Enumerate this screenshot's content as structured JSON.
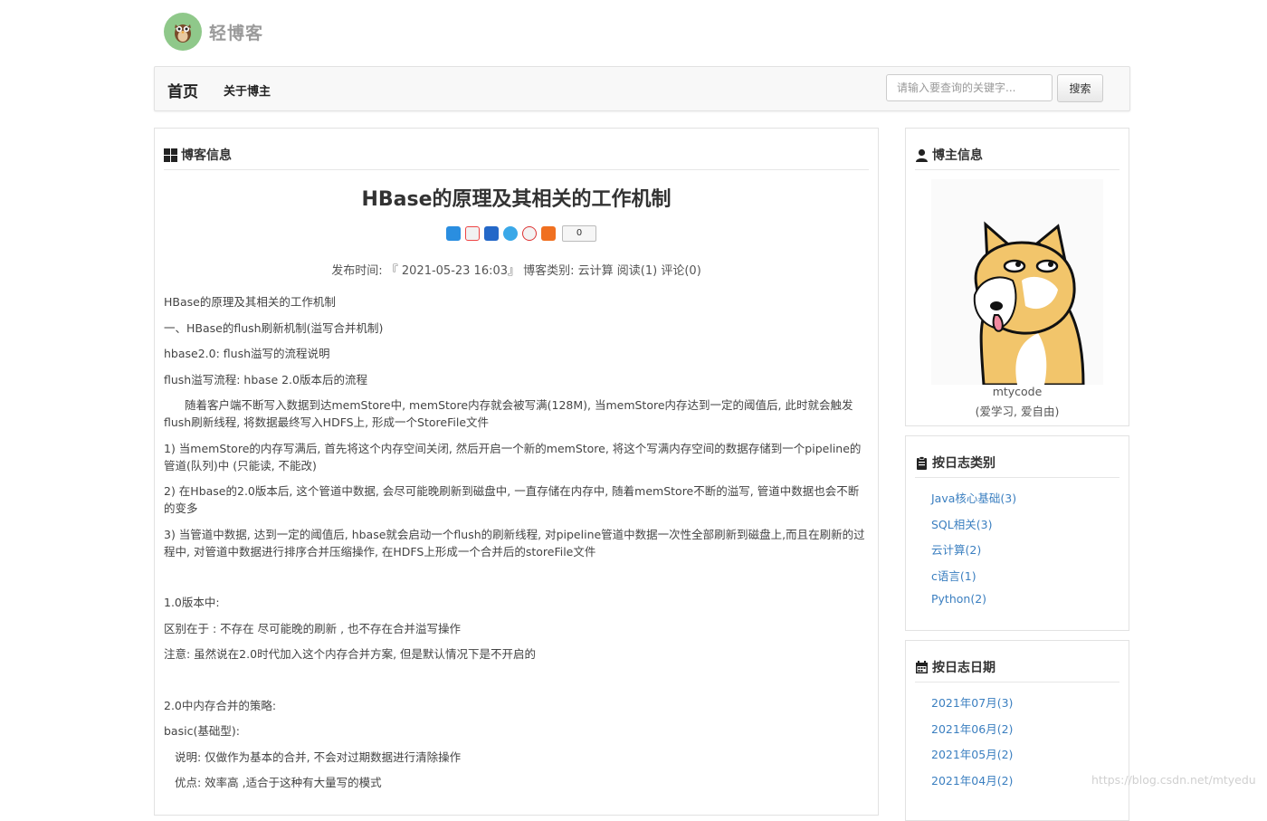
{
  "brand": {
    "name": "轻博客",
    "logo_icon": "owl-logo-icon"
  },
  "nav": {
    "home": "首页",
    "about": "关于博主",
    "search_placeholder": "请输入要查询的关键字...",
    "search_button": "搜索"
  },
  "main": {
    "panel_title": "博客信息",
    "article": {
      "title": "HBase的原理及其相关的工作机制",
      "share_count": "0",
      "meta": "发布时间: 『 2021-05-23 16:03』  博客类别: 云计算  阅读(1) 评论(0)",
      "paragraphs": [
        "HBase的原理及其相关的工作机制",
        "一、HBase的flush刷新机制(溢写合并机制)",
        "hbase2.0: flush溢写的流程说明",
        "flush溢写流程:   hbase 2.0版本后的流程",
        "随着客户端不断写入数据到达memStore中, memStore内存就会被写满(128M), 当memStore内存达到一定的阈值后, 此时就会触发flush刷新线程, 将数据最终写入HDFS上, 形成一个StoreFile文件",
        "1) 当memStore的内存写满后, 首先将这个内存空间关闭, 然后开启一个新的memStore, 将这个写满内存空间的数据存储到一个pipeline的管道(队列)中 (只能读, 不能改)",
        "2) 在Hbase的2.0版本后, 这个管道中数据, 会尽可能晚刷新到磁盘中, 一直存储在内存中, 随着memStore不断的溢写, 管道中数据也会不断的变多",
        "3) 当管道中数据, 达到一定的阈值后, hbase就会启动一个flush的刷新线程, 对pipeline管道中数据一次性全部刷新到磁盘上,而且在刷新的过程中, 对管道中数据进行排序合并压缩操作, 在HDFS上形成一个合并后的storeFile文件",
        "1.0版本中:",
        "区别在于 : 不存在 尽可能晚的刷新 , 也不存在合并溢写操作",
        "注意: 虽然说在2.0时代加入这个内存合并方案, 但是默认情况下是不开启的",
        "2.0中内存合并的策略:",
        "basic(基础型):",
        "说明: 仅做作为基本的合并, 不会对过期数据进行清除操作",
        "优点: 效率高 ,适合于这种有大量写的模式"
      ]
    }
  },
  "sidebar": {
    "author": {
      "title": "博主信息",
      "name": "mtycode",
      "motto": "(爱学习, 爱自由)"
    },
    "categories": {
      "title": "按日志类别",
      "items": [
        "Java核心基础(3)",
        "SQL相关(3)",
        "云计算(2)",
        "c语言(1)",
        "Python(2)"
      ]
    },
    "dates": {
      "title": "按日志日期",
      "items": [
        "2021年07月(3)",
        "2021年06月(2)",
        "2021年05月(2)",
        "2021年04月(2)"
      ]
    }
  },
  "watermark": "https://blog.csdn.net/mtyedu",
  "colors": {
    "link": "#3b7fc0",
    "brand_green": "#8fc88a"
  }
}
